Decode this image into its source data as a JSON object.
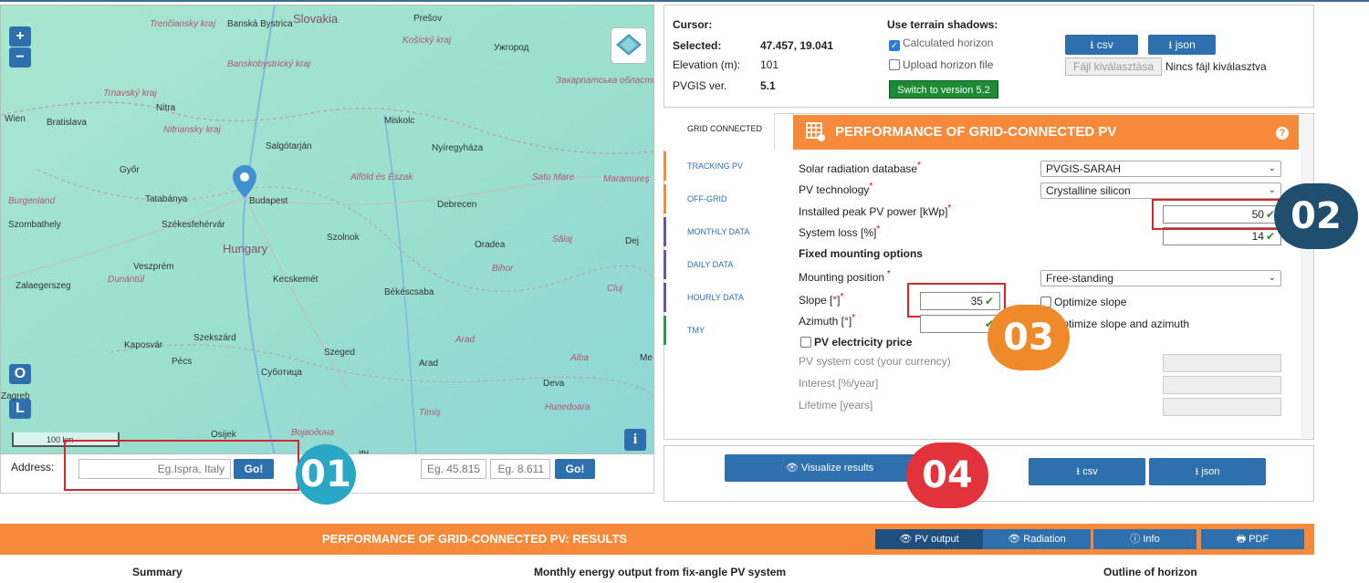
{
  "map": {
    "zoom_in": "+",
    "zoom_out": "−",
    "layer_o": "O",
    "layer_l": "L",
    "scale": "100 km",
    "info": "i",
    "places": [
      {
        "name": "Trenčiansky kraj",
        "cls": "it"
      },
      {
        "name": "Banská Bystrica",
        "cls": ""
      },
      {
        "name": "Banskobystrický kraj",
        "cls": "it"
      },
      {
        "name": "Slovakia",
        "cls": "big"
      },
      {
        "name": "Prešov",
        "cls": ""
      },
      {
        "name": "Košický kraj",
        "cls": "it"
      },
      {
        "name": "Ужгород",
        "cls": ""
      },
      {
        "name": "Закарпатська область",
        "cls": "it"
      },
      {
        "name": "Trnavský kraj",
        "cls": "it"
      },
      {
        "name": "Nitra",
        "cls": ""
      },
      {
        "name": "Wien",
        "cls": ""
      },
      {
        "name": "Bratislava",
        "cls": ""
      },
      {
        "name": "Nitriansky kraj",
        "cls": "it"
      },
      {
        "name": "Miskolc",
        "cls": ""
      },
      {
        "name": "Salgótarján",
        "cls": ""
      },
      {
        "name": "Nyíregyháza",
        "cls": ""
      },
      {
        "name": "Győr",
        "cls": ""
      },
      {
        "name": "Alföld és Észak",
        "cls": "it"
      },
      {
        "name": "Satu Mare",
        "cls": "it"
      },
      {
        "name": "Maramureș",
        "cls": "it"
      },
      {
        "name": "Burgenland",
        "cls": "it"
      },
      {
        "name": "Tatabánya",
        "cls": ""
      },
      {
        "name": "Budapest",
        "cls": ""
      },
      {
        "name": "Debrecen",
        "cls": ""
      },
      {
        "name": "Szombathely",
        "cls": ""
      },
      {
        "name": "Székesfehérvár",
        "cls": ""
      },
      {
        "name": "Szolnok",
        "cls": ""
      },
      {
        "name": "Hungary",
        "cls": "big"
      },
      {
        "name": "Oradea",
        "cls": ""
      },
      {
        "name": "Sălaj",
        "cls": "it"
      },
      {
        "name": "Dej",
        "cls": ""
      },
      {
        "name": "Veszprém",
        "cls": ""
      },
      {
        "name": "Dunántúl",
        "cls": "it"
      },
      {
        "name": "Bihor",
        "cls": "it"
      },
      {
        "name": "Zalaegerszeg",
        "cls": ""
      },
      {
        "name": "Kecskemét",
        "cls": ""
      },
      {
        "name": "Békéscsaba",
        "cls": ""
      },
      {
        "name": "Cluj",
        "cls": "it"
      },
      {
        "name": "Szekszárd",
        "cls": ""
      },
      {
        "name": "Kaposvár",
        "cls": ""
      },
      {
        "name": "Arad",
        "cls": "it"
      },
      {
        "name": "Szeged",
        "cls": ""
      },
      {
        "name": "Pécs",
        "cls": ""
      },
      {
        "name": "Arad",
        "cls": ""
      },
      {
        "name": "Alba",
        "cls": "it"
      },
      {
        "name": "Me",
        "cls": ""
      },
      {
        "name": "Суботица",
        "cls": ""
      },
      {
        "name": "Deva",
        "cls": ""
      },
      {
        "name": "Zagreb",
        "cls": ""
      },
      {
        "name": "Timiș",
        "cls": "it"
      },
      {
        "name": "Hunedoara",
        "cls": "it"
      },
      {
        "name": "Osijek",
        "cls": ""
      },
      {
        "name": "Војводина",
        "cls": "it"
      },
      {
        "name": "ин",
        "cls": ""
      }
    ]
  },
  "address": {
    "label": "Address:",
    "placeholder": "Eg.Ispra, Italy",
    "go": "Go!",
    "lat_placeholder": "Eg. 45.815",
    "lon_placeholder": "Eg. 8.611",
    "go2": "Go!"
  },
  "info": {
    "cursor_label": "Cursor:",
    "selected_label": "Selected:",
    "selected_value": "47.457, 19.041",
    "elevation_label": "Elevation (m):",
    "elevation_value": "101",
    "pvgis_label": "PVGIS ver.",
    "pvgis_value": "5.1",
    "shadows_title": "Use terrain shadows:",
    "calc_horizon": "Calculated horizon",
    "upload_horizon": "Upload horizon file",
    "switch_version": "Switch to version 5.2",
    "csv": "csv",
    "json": "json",
    "file_choose": "Fájl kiválasztása",
    "no_file": "Nincs fájl kiválasztva"
  },
  "tabs": [
    {
      "label": "GRID CONNECTED",
      "color": "#ffffff"
    },
    {
      "label": "TRACKING PV",
      "color": "#f6893a"
    },
    {
      "label": "OFF-GRID",
      "color": "#f6893a"
    },
    {
      "label": "MONTHLY DATA",
      "color": "#6b55a6"
    },
    {
      "label": "DAILY DATA",
      "color": "#6b55a6"
    },
    {
      "label": "HOURLY DATA",
      "color": "#6b55a6"
    },
    {
      "label": "TMY",
      "color": "#2b9a4a"
    }
  ],
  "form": {
    "header": "PERFORMANCE OF GRID-CONNECTED PV",
    "help": "?",
    "db_label": "Solar radiation database",
    "db_value": "PVGIS-SARAH",
    "tech_label": "PV technology",
    "tech_value": "Crystalline silicon",
    "peak_label": "Installed peak PV power [kWp]",
    "peak_value": "50",
    "loss_label": "System loss [%]",
    "loss_value": "14",
    "fixed_title": "Fixed mounting options",
    "mount_label": "Mounting position",
    "mount_value": "Free-standing",
    "slope_label": "Slope [°]",
    "slope_value": "35",
    "opt_slope": "Optimize slope",
    "azimuth_label": "Azimuth [°]",
    "azimuth_value": "",
    "opt_slope_az": "Optimize slope and azimuth",
    "price_title": "PV electricity price",
    "cost_label": "PV system cost (your currency)",
    "interest_label": "Interest [%/year]",
    "lifetime_label": "Lifetime [years]",
    "req": "*"
  },
  "visualize": {
    "visualize": "Visualize results",
    "csv": "csv",
    "json": "json"
  },
  "results": {
    "title": "PERFORMANCE OF GRID-CONNECTED PV: RESULTS",
    "pv_output": "PV output",
    "radiation": "Radiation",
    "info": "Info",
    "pdf": "PDF",
    "summary": "Summary",
    "monthly": "Monthly energy output from fix-angle PV system",
    "horizon": "Outline of horizon"
  },
  "badges": {
    "b01": "01",
    "b02": "02",
    "b03": "03",
    "b04": "04"
  },
  "colors": {
    "accent": "#f6893a",
    "primary_blue": "#2e6fae",
    "badge_teal": "#2aa7c4",
    "badge_navy": "#1f4e6e",
    "badge_orange": "#ef8a2a",
    "badge_red": "#e2333c"
  }
}
